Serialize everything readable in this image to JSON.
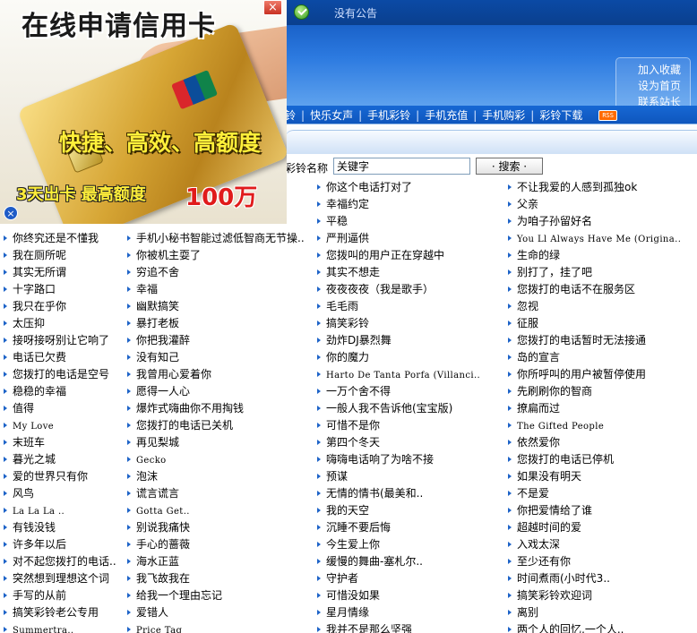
{
  "top": {
    "notice": "没有公告"
  },
  "quick_links": [
    "加入收藏",
    "设为首页",
    "联系站长"
  ],
  "nav": {
    "items": [
      "铃",
      "快乐女声",
      "手机彩铃",
      "手机充值",
      "手机购彩",
      "彩铃下载"
    ],
    "rss": "RSS"
  },
  "search": {
    "label": "彩铃名称",
    "value": "关键字",
    "button": "· 搜索 ·"
  },
  "ad": {
    "title": "在线申请信用卡",
    "slogan": "快捷、高效、高额度",
    "bottom_left": "3天出卡  最高额度",
    "amount": "100万",
    "close": "×",
    "dismiss": "×"
  },
  "songs": {
    "col1": [
      "你终究还是不懂我",
      "我在厕所呢",
      "其实无所谓",
      "十字路口",
      "我只在乎你",
      "太压抑",
      "接呀接呀别让它响了",
      "电话已欠费",
      "您拨打的电话是空号",
      "稳稳的幸福",
      "值得",
      "My Love",
      "末班车",
      "暮光之城",
      "爱的世界只有你",
      "风鸟",
      "La La La ..",
      "有钱没钱",
      "许多年以后",
      "对不起您拨打的电话..",
      "突然想到理想这个词",
      "手写的从前",
      "搞笑彩铃老公专用",
      "Summertra.."
    ],
    "col2": [
      "手机小秘书智能过滤低智商无节操..",
      "你被机主耍了",
      "穷追不舍",
      "幸福",
      "幽默搞笑",
      "暴打老板",
      "你把我灌醉",
      "没有知己",
      "我曾用心爱着你",
      "愿得一人心",
      "爆炸式嗨曲你不用掏钱",
      "您拨打的电话已关机",
      "再见梨城",
      "Gecko",
      "泡沫",
      "谎言谎言",
      "Gotta Get..",
      "别说我痛快",
      "手心的蔷薇",
      "海水正蓝",
      "我飞故我在",
      "给我一个理由忘记",
      "爱错人",
      "Price Tag"
    ],
    "col3": [
      "你这个电话打对了",
      "幸福约定",
      "平稳",
      "严刑逼供",
      "您拨叫的用户正在穿越中",
      "其实不想走",
      "夜夜夜夜（我是歌手）",
      "毛毛雨",
      "搞笑彩铃",
      "劲炸DJ暴烈舞",
      "你的魔力",
      "Harto De Tanta Porfa (Villanci..",
      "一万个舍不得",
      "一般人我不告诉他(宝宝版)",
      "可惜不是你",
      "第四个冬天",
      "嗨嗨电话响了为啥不接",
      "预谋",
      "无情的情书(最美和..",
      "我的天空",
      "沉睡不要后悔",
      "今生爱上你",
      "缓慢的舞曲-塞札尔..",
      "守护者",
      "可惜没如果",
      "星月情缘",
      "我并不是那么坚强"
    ],
    "col4": [
      "不让我爱的人感到孤独ok",
      "父亲",
      "为咱子孙留好名",
      "You Ll Always Have Me (Origina..",
      "生命的绿",
      "别打了，挂了吧",
      "您拨打的电话不在服务区",
      "忽视",
      "征服",
      "您拨打的电话暂时无法接通",
      "岛的宣言",
      "你所呼叫的用户被暂停使用",
      "先刷刷你的智商",
      "撩扁而过",
      "The Gifted People",
      "依然爱你",
      "您拨打的电话已停机",
      "如果没有明天",
      "不是爱",
      "你把爱情给了谁",
      "超越时间的爱",
      "入戏太深",
      "至少还有你",
      "时间煮雨(小时代3..",
      "搞笑彩铃欢迎词",
      "离别",
      "两个人的回忆,一个人.."
    ]
  },
  "colors": {
    "accent": "#1d63c8",
    "header": "#2c7ae0",
    "nav": "#1768d4",
    "ad_amount": "#e01b1b",
    "ad_slogan": "#ffef3a"
  },
  "icons": {
    "notice": "check-circle-icon",
    "close": "close-icon",
    "bullet": "triangle-bullet-icon"
  }
}
